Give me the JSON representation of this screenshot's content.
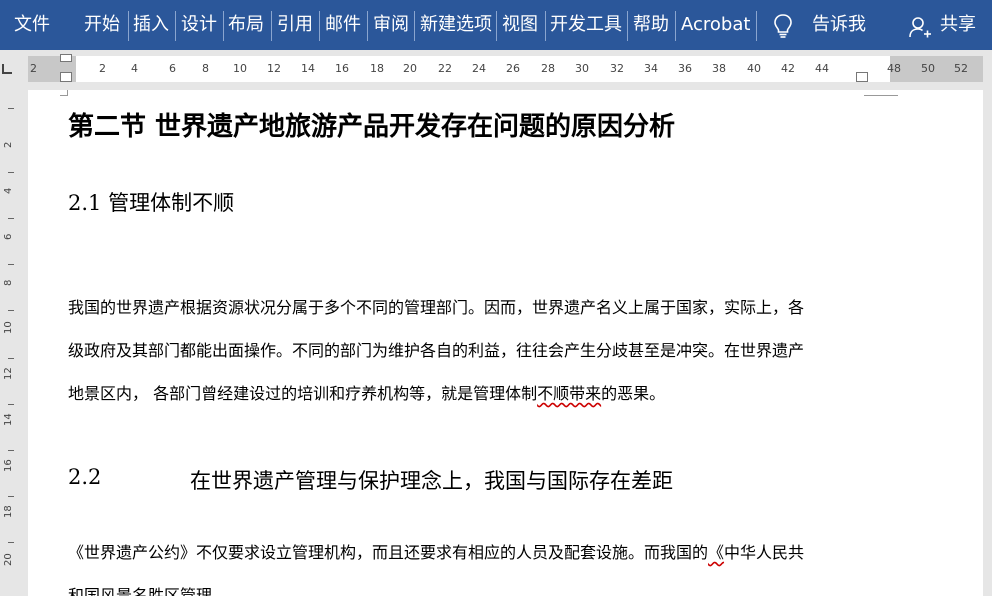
{
  "ribbon": {
    "tabs": [
      "文件",
      "开始",
      "插入",
      "设计",
      "布局",
      "引用",
      "邮件",
      "审阅",
      "新建选项",
      "视图",
      "开发工具",
      "帮助",
      "Acrobat"
    ],
    "tell_me": "告诉我",
    "share": "共享",
    "accent": "#2b579a"
  },
  "ruler": {
    "h_labels": [
      "2",
      "2",
      "4",
      "6",
      "8",
      "10",
      "12",
      "14",
      "16",
      "18",
      "20",
      "22",
      "24",
      "26",
      "28",
      "30",
      "32",
      "34",
      "36",
      "38",
      "40",
      "42",
      "44",
      "48",
      "50",
      "52"
    ],
    "v_labels": [
      "2",
      "4",
      "6",
      "8",
      "10",
      "12",
      "14",
      "16",
      "18",
      "20"
    ]
  },
  "document": {
    "section_title": "第二节      世界遗产地旅游产品开发存在问题的原因分析",
    "heading_1": "2.1  管理体制不顺",
    "para_1_line_1": "我国的世界遗产根据资源状况分属于多个不同的管理部门。因而，世界遗产名义上属于国家，实际上，各",
    "para_1_line_2": "级政府及其部门都能出面操作。不同的部门为维护各自的利益，往往会产生分歧甚至是冲突。在世界遗产",
    "para_1_line_3_a": "地景区内，  各部门曾经建设过的培训和疗养机构等，就是管理体制",
    "para_1_line_3_b": "不顺带来",
    "para_1_line_3_c": "的恶果。",
    "heading_2_num": "2.2",
    "heading_2_text": "在世界遗产管理与保护理念上，我国与国际存在差距",
    "para_2_line_1_a": "《世界遗产公约》不仅要求设立管理机构，而且还要求有相应的人员及配套设施。而我国的",
    "para_2_line_1_b": "《",
    "para_2_line_1_c": "中华人民共",
    "para_2_line_2": "和国风景名胜区管理"
  }
}
